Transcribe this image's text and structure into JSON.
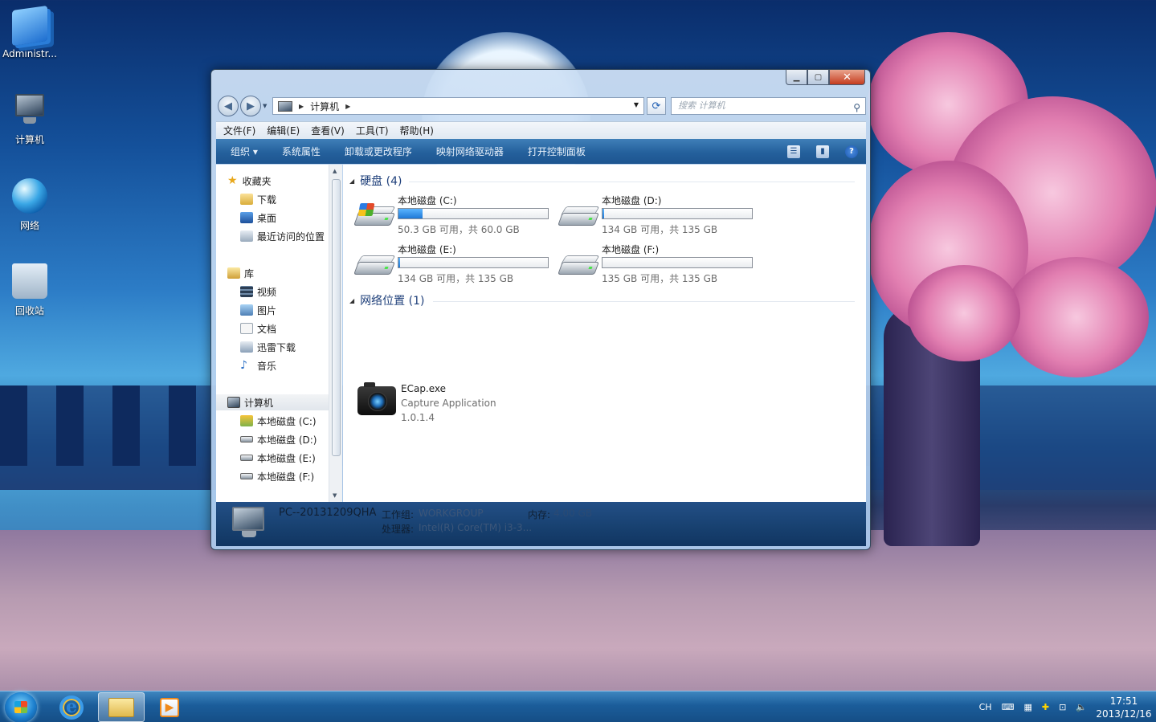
{
  "desktop": {
    "icons": [
      {
        "label": "Administr..."
      },
      {
        "label": "计算机"
      },
      {
        "label": "网络"
      },
      {
        "label": "回收站"
      }
    ]
  },
  "window": {
    "address": {
      "crumb": "计算机"
    },
    "search": {
      "placeholder": "搜索 计算机"
    },
    "menu": [
      "文件(F)",
      "编辑(E)",
      "查看(V)",
      "工具(T)",
      "帮助(H)"
    ],
    "commands": [
      "组织 ▾",
      "系统属性",
      "卸载或更改程序",
      "映射网络驱动器",
      "打开控制面板"
    ],
    "nav": {
      "favorites": {
        "label": "收藏夹",
        "items": [
          "下载",
          "桌面",
          "最近访问的位置"
        ]
      },
      "library": {
        "label": "库",
        "items": [
          "视频",
          "图片",
          "文档",
          "迅雷下载",
          "音乐"
        ]
      },
      "computer": {
        "label": "计算机",
        "items": [
          "本地磁盘 (C:)",
          "本地磁盘 (D:)",
          "本地磁盘 (E:)",
          "本地磁盘 (F:)"
        ]
      }
    },
    "groups": {
      "hard_disks": "硬盘 (4)",
      "network": "网络位置 (1)"
    },
    "drives": [
      {
        "name": "本地磁盘 (C:)",
        "free": "50.3 GB 可用，共 60.0 GB",
        "used_fraction": 0.16
      },
      {
        "name": "本地磁盘 (D:)",
        "free": "134 GB 可用，共 135 GB",
        "used_fraction": 0.01
      },
      {
        "name": "本地磁盘 (E:)",
        "free": "134 GB 可用，共 135 GB",
        "used_fraction": 0.01
      },
      {
        "name": "本地磁盘 (F:)",
        "free": "135 GB 可用，共 135 GB",
        "used_fraction": 0.0
      }
    ],
    "network_item": {
      "name": "ECap.exe",
      "description": "Capture Application",
      "version": "1.0.1.4"
    },
    "details": {
      "pc_name": "PC--20131209QHA",
      "workgroup_label": "工作组:",
      "workgroup_value": "WORKGROUP",
      "memory_label": "内存:",
      "memory_value": "4.00 GB",
      "cpu_label": "处理器:",
      "cpu_value": "Intel(R) Core(TM) i3-3..."
    }
  },
  "taskbar": {
    "tray": {
      "lang": "CH"
    },
    "clock": {
      "time": "17:51",
      "date": "2013/12/16"
    }
  },
  "colors": {
    "command_bar": "#24609c",
    "details_pane": "#17406f",
    "progress_fill": "#1f78d6",
    "group_header": "#1e3f7a"
  }
}
